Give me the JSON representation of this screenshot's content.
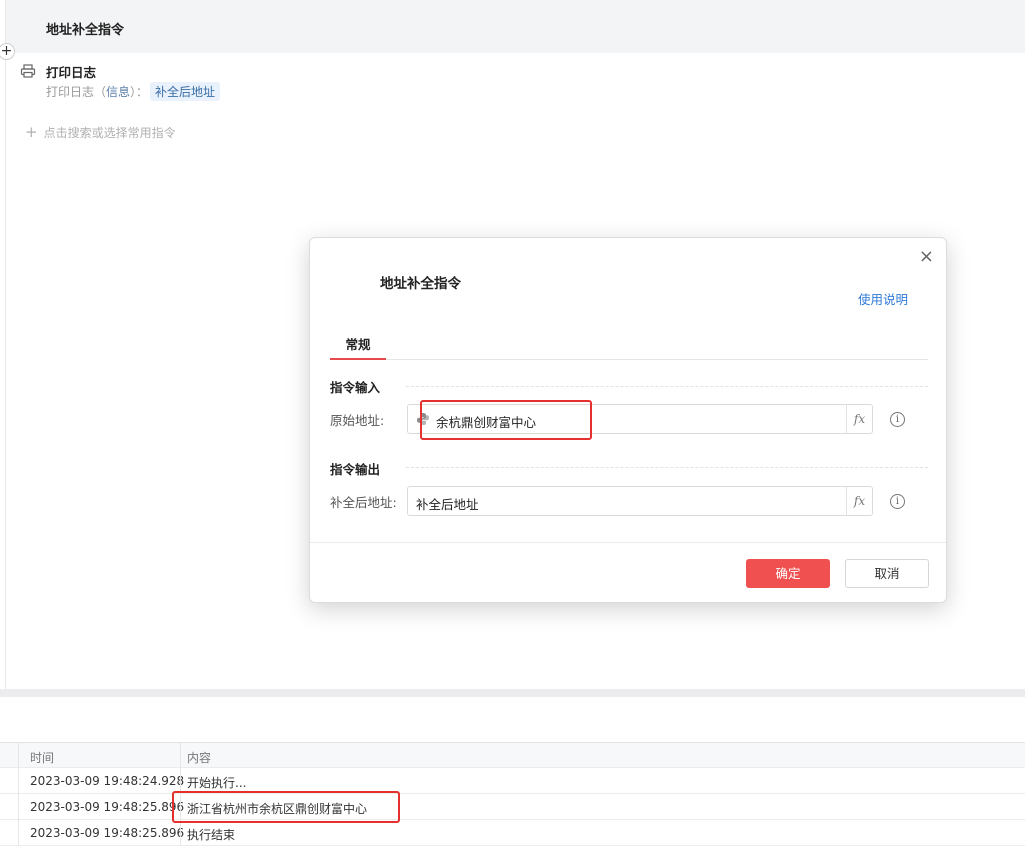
{
  "editor": {
    "title": "地址补全指令",
    "command": {
      "icon": "printer-icon",
      "title": "打印日志",
      "desc_prefix": "打印日志（",
      "desc_level": "信息",
      "desc_suffix": "）：",
      "desc_var": "补全后地址"
    },
    "add_command_label": "点击搜索或选择常用指令"
  },
  "modal": {
    "title": "地址补全指令",
    "help_link": "使用说明",
    "tabs": [
      {
        "label": "常规",
        "active": true
      }
    ],
    "input_section": "指令输入",
    "output_section": "指令输出",
    "fields": {
      "source_address": {
        "label": "原始地址:",
        "value": "余杭鼎创财富中心",
        "value_icon": "python-icon"
      },
      "completed_address": {
        "label": "补全后地址:",
        "value": "补全后地址"
      }
    },
    "fx_label": "fx",
    "info_glyph": "i",
    "ok_label": "确定",
    "cancel_label": "取消",
    "close_glyph": "×"
  },
  "log": {
    "columns": [
      "时间",
      "内容"
    ],
    "rows": [
      {
        "time": "2023-03-09 19:48:24.928",
        "content": "开始执行..."
      },
      {
        "time": "2023-03-09 19:48:25.896",
        "content": "浙江省杭州市余杭区鼎创财富中心"
      },
      {
        "time": "2023-03-09 19:48:25.896",
        "content": "执行结束"
      }
    ]
  },
  "colors": {
    "accent_red": "#f0504f",
    "link_blue": "#2f7ad6",
    "highlight_box": "#e5312e"
  }
}
